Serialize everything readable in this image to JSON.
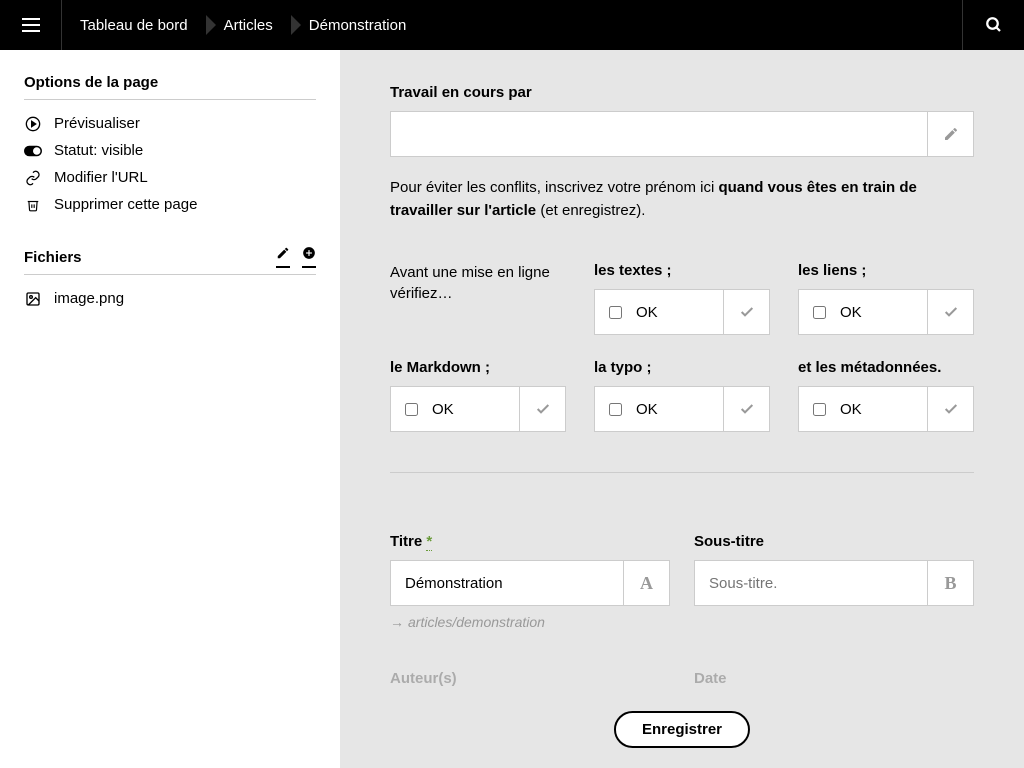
{
  "breadcrumbs": [
    "Tableau de bord",
    "Articles",
    "Démonstration"
  ],
  "sidebar": {
    "options_heading": "Options de la page",
    "items": [
      {
        "label": "Prévisualiser",
        "icon": "play"
      },
      {
        "label": "Statut: visible",
        "icon": "toggle"
      },
      {
        "label": "Modifier l'URL",
        "icon": "link"
      },
      {
        "label": "Supprimer cette page",
        "icon": "trash"
      }
    ],
    "files_heading": "Fichiers",
    "files": [
      {
        "name": "image.png",
        "icon": "image"
      }
    ]
  },
  "wip": {
    "label": "Travail en cours par",
    "value": "",
    "help_prefix": "Pour éviter les conflits, inscrivez votre prénom ici ",
    "help_bold": "quand vous êtes en train de travailler sur l'article",
    "help_suffix": " (et enregistrez)."
  },
  "checks": {
    "prompt": "Avant une mise en ligne vérifiez…",
    "items": [
      {
        "label": "les textes ;",
        "ok": "OK"
      },
      {
        "label": "les liens ;",
        "ok": "OK"
      },
      {
        "label": "le Markdown ;",
        "ok": "OK"
      },
      {
        "label": "la typo ;",
        "ok": "OK"
      },
      {
        "label": "et les métadonnées.",
        "ok": "OK"
      }
    ]
  },
  "title": {
    "label": "Titre ",
    "required_mark": "*",
    "value": "Démonstration",
    "slug_arrow": "→",
    "slug": "articles/demonstration"
  },
  "subtitle": {
    "label": "Sous-titre",
    "placeholder": "Sous-titre."
  },
  "faded": {
    "authors": "Auteur(s)",
    "date": "Date"
  },
  "save_label": "Enregistrer"
}
